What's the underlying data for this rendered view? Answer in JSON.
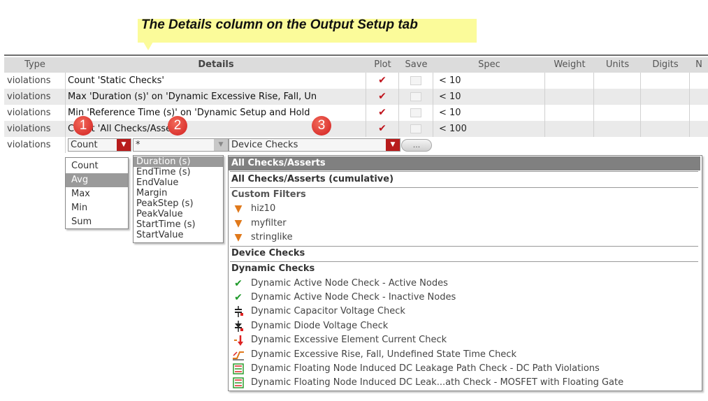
{
  "callout": {
    "text": "The Details column on the Output Setup tab",
    "color": "#fbfb9a"
  },
  "columns": {
    "type": "Type",
    "details": "Details",
    "plot": "Plot",
    "save": "Save",
    "spec": "Spec",
    "weight": "Weight",
    "units": "Units",
    "digits": "Digits",
    "more": "N"
  },
  "rows": [
    {
      "type": "violations",
      "details": "Count 'Static Checks'",
      "plot": true,
      "save": false,
      "spec": "<  10"
    },
    {
      "type": "violations",
      "details": "Max 'Duration (s)' on 'Dynamic Excessive Rise, Fall, Un",
      "plot": true,
      "save": false,
      "spec": "<  10"
    },
    {
      "type": "violations",
      "details": "Min 'Reference Time (s)' on 'Dynamic Setup and Hold",
      "plot": true,
      "save": false,
      "spec": "<  10"
    },
    {
      "type": "violations",
      "details": "Count 'All Checks/Asserts'",
      "plot": true,
      "save": false,
      "spec": "<  100"
    }
  ],
  "edit_row": {
    "type": "violations",
    "function_value": "Count",
    "field_value": "*",
    "filter_value": "Device Checks",
    "ellipsis": "..."
  },
  "badges": [
    "1",
    "2",
    "3"
  ],
  "dropdown_function": {
    "options": [
      "Count",
      "Avg",
      "Max",
      "Min",
      "Sum"
    ],
    "selected": "Avg"
  },
  "dropdown_field": {
    "options": [
      "Duration (s)",
      "EndTime (s)",
      "EndValue",
      "Margin",
      "PeakStep (s)",
      "PeakValue",
      "StartTime (s)",
      "StartValue"
    ],
    "selected": "Duration (s)"
  },
  "dropdown_filter": {
    "selected": "All Checks/Asserts",
    "cumulative": "All Checks/Asserts (cumulative)",
    "custom_filters_header": "Custom Filters",
    "custom_filters": [
      {
        "label": "hiz10",
        "icon": "funnel-icon"
      },
      {
        "label": "myfilter",
        "icon": "funnel-icon"
      },
      {
        "label": "stringlike",
        "icon": "funnel-icon"
      }
    ],
    "device_checks": "Device Checks",
    "dynamic_checks_header": "Dynamic Checks",
    "dynamic_checks": [
      {
        "label": "Dynamic Active Node Check - Active Nodes",
        "icon": "green-check-icon"
      },
      {
        "label": "Dynamic Active Node Check - Inactive Nodes",
        "icon": "green-check-icon"
      },
      {
        "label": "Dynamic Capacitor Voltage Check",
        "icon": "capacitor-icon"
      },
      {
        "label": "Dynamic Diode Voltage Check",
        "icon": "diode-icon"
      },
      {
        "label": "Dynamic Excessive Element Current Check",
        "icon": "current-arrow-icon"
      },
      {
        "label": "Dynamic Excessive Rise, Fall, Undefined State Time Check",
        "icon": "rise-fall-icon"
      },
      {
        "label": "Dynamic Floating Node Induced DC Leakage Path Check - DC Path Violations",
        "icon": "floating-node-icon"
      },
      {
        "label": "Dynamic Floating Node Induced DC Leak...ath Check - MOSFET with Floating Gate",
        "icon": "floating-node-icon"
      }
    ]
  },
  "colors": {
    "accent_red": "#b81c1c",
    "check_red": "#c0141d",
    "selection_grey": "#808080",
    "filter_orange": "#e0791b",
    "check_green": "#1f9a2a"
  }
}
